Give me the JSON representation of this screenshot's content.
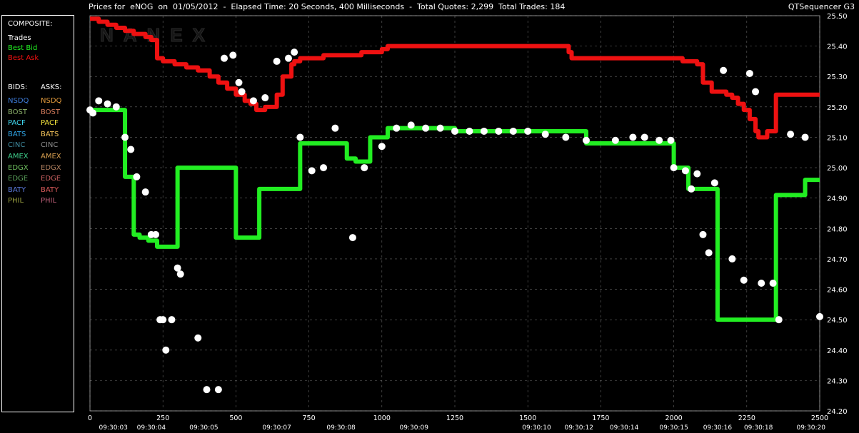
{
  "title": "Prices for  eNOG  on  01/05/2012  -  Elapsed Time: 20 Seconds, 400 Milliseconds  -  Total Quotes: 2,299  Total Trades: 184",
  "app_name": "QTSequencer G3",
  "watermark": "NANEX",
  "legend": {
    "composite_header": "COMPOSITE:",
    "composite_items": [
      {
        "label": "Trades",
        "color": "#ffffff"
      },
      {
        "label": "Best Bid",
        "color": "#22ee22"
      },
      {
        "label": "Best Ask",
        "color": "#ee1111"
      }
    ],
    "bids_header": "BIDS:",
    "asks_header": "ASKS:",
    "exchanges": [
      {
        "bid": "NSDQ",
        "ask": "NSDQ",
        "bid_color": "#3f7fe0",
        "ask_color": "#e39b3c"
      },
      {
        "bid": "BOST",
        "ask": "BOST",
        "bid_color": "#8cb06a",
        "ask_color": "#d47a5a"
      },
      {
        "bid": "PACF",
        "ask": "PACF",
        "bid_color": "#3fd6ee",
        "ask_color": "#f2e23c"
      },
      {
        "bid": "BATS",
        "ask": "BATS",
        "bid_color": "#2fa6e8",
        "ask_color": "#f5c45a"
      },
      {
        "bid": "CINC",
        "ask": "CINC",
        "bid_color": "#3f8a9e",
        "ask_color": "#8c8c8c"
      },
      {
        "bid": "AMEX",
        "ask": "AMEX",
        "bid_color": "#3fcf8c",
        "ask_color": "#d9a050"
      },
      {
        "bid": "EDGX",
        "ask": "EDGX",
        "bid_color": "#6fbf5f",
        "ask_color": "#b08060"
      },
      {
        "bid": "EDGE",
        "ask": "EDGE",
        "bid_color": "#5aa05a",
        "ask_color": "#c96060"
      },
      {
        "bid": "BATY",
        "ask": "BATY",
        "bid_color": "#5a78d8",
        "ask_color": "#d85a5a"
      },
      {
        "bid": "PHIL",
        "ask": "PHIL",
        "bid_color": "#9aa040",
        "ask_color": "#c0607a"
      }
    ]
  },
  "colors": {
    "background": "#000000",
    "grid": "#bbbbbb",
    "best_bid": "#22ee22",
    "best_ask": "#ee1111",
    "trades": "#ffffff",
    "text": "#ffffff"
  },
  "chart_data": {
    "type": "line",
    "ylim": [
      24.2,
      25.5
    ],
    "y_ticks": [
      "25.50",
      "25.40",
      "25.30",
      "25.20",
      "25.10",
      "25.00",
      "24.90",
      "24.80",
      "24.70",
      "24.60",
      "24.50",
      "24.40",
      "24.30",
      "24.20"
    ],
    "xlim": [
      0,
      2500
    ],
    "x_ticks": [
      "0",
      "250",
      "500",
      "750",
      "1000",
      "1250",
      "1500",
      "1750",
      "2000",
      "2250",
      "2500"
    ],
    "time_labels": [
      {
        "x": 80,
        "label": "09:30:03"
      },
      {
        "x": 210,
        "label": "09:30:04"
      },
      {
        "x": 390,
        "label": "09:30:05"
      },
      {
        "x": 640,
        "label": "09:30:07"
      },
      {
        "x": 860,
        "label": "09:30:08"
      },
      {
        "x": 1110,
        "label": "09:30:09"
      },
      {
        "x": 1530,
        "label": "09:30:10"
      },
      {
        "x": 1675,
        "label": "09:30:12"
      },
      {
        "x": 1830,
        "label": "09:30:14"
      },
      {
        "x": 2000,
        "label": "09:30:15"
      },
      {
        "x": 2150,
        "label": "09:30:16"
      },
      {
        "x": 2290,
        "label": "09:30:18"
      },
      {
        "x": 2470,
        "label": "09:30:20"
      }
    ],
    "grid": true,
    "series": [
      {
        "name": "Best Ask",
        "color": "#ee1111",
        "x": [
          0,
          30,
          60,
          90,
          120,
          150,
          190,
          210,
          230,
          250,
          290,
          330,
          370,
          410,
          440,
          470,
          500,
          530,
          550,
          570,
          580,
          600,
          640,
          660,
          690,
          700,
          720,
          760,
          800,
          860,
          930,
          1000,
          1020,
          1050,
          1080,
          1100,
          1150,
          1200,
          1250,
          1300,
          1350,
          1400,
          1450,
          1480,
          1500,
          1550,
          1600,
          1640,
          1650,
          1700,
          1750,
          1800,
          1850,
          1900,
          1950,
          2000,
          2030,
          2050,
          2080,
          2100,
          2130,
          2150,
          2180,
          2200,
          2220,
          2240,
          2260,
          2280,
          2290,
          2320,
          2350,
          2400,
          2450,
          2500
        ],
        "y": [
          25.49,
          25.48,
          25.47,
          25.46,
          25.45,
          25.44,
          25.43,
          25.42,
          25.36,
          25.35,
          25.34,
          25.33,
          25.32,
          25.3,
          25.28,
          25.26,
          25.24,
          25.22,
          25.21,
          25.19,
          25.19,
          25.2,
          25.24,
          25.3,
          25.34,
          25.35,
          25.36,
          25.36,
          25.37,
          25.37,
          25.38,
          25.39,
          25.4,
          25.4,
          25.4,
          25.4,
          25.4,
          25.4,
          25.4,
          25.4,
          25.4,
          25.4,
          25.4,
          25.4,
          25.4,
          25.4,
          25.4,
          25.38,
          25.36,
          25.36,
          25.36,
          25.36,
          25.36,
          25.36,
          25.36,
          25.36,
          25.35,
          25.35,
          25.34,
          25.28,
          25.25,
          25.25,
          25.24,
          25.23,
          25.21,
          25.19,
          25.16,
          25.12,
          25.1,
          25.12,
          25.24,
          25.24,
          25.24,
          25.24
        ]
      },
      {
        "name": "Best Bid",
        "color": "#22ee22",
        "x": [
          0,
          30,
          60,
          80,
          90,
          120,
          150,
          170,
          200,
          230,
          270,
          300,
          370,
          410,
          480,
          500,
          520,
          540,
          560,
          580,
          640,
          660,
          700,
          720,
          760,
          800,
          860,
          880,
          910,
          960,
          1000,
          1020,
          1050,
          1080,
          1150,
          1200,
          1250,
          1300,
          1400,
          1500,
          1550,
          1600,
          1650,
          1700,
          1750,
          1800,
          1850,
          1900,
          1950,
          2000,
          2050,
          2100,
          2150,
          2200,
          2250,
          2300,
          2320,
          2350,
          2400,
          2450,
          2500
        ],
        "y": [
          25.19,
          25.19,
          25.19,
          25.19,
          25.19,
          24.97,
          24.78,
          24.77,
          24.76,
          24.74,
          24.74,
          25.0,
          25.0,
          25.0,
          25.0,
          24.77,
          24.77,
          24.77,
          24.77,
          24.93,
          24.93,
          24.93,
          24.93,
          25.08,
          25.08,
          25.08,
          25.08,
          25.03,
          25.02,
          25.1,
          25.1,
          25.13,
          25.13,
          25.13,
          25.13,
          25.13,
          25.12,
          25.12,
          25.12,
          25.12,
          25.12,
          25.12,
          25.12,
          25.08,
          25.08,
          25.08,
          25.08,
          25.08,
          25.08,
          25.0,
          24.93,
          24.93,
          24.5,
          24.5,
          24.5,
          24.5,
          24.5,
          24.91,
          24.91,
          24.96,
          24.96
        ]
      },
      {
        "name": "Trades",
        "color": "#ffffff",
        "x": [
          0,
          10,
          30,
          60,
          90,
          120,
          140,
          160,
          190,
          210,
          225,
          240,
          250,
          260,
          280,
          300,
          310,
          370,
          400,
          440,
          460,
          490,
          510,
          520,
          560,
          600,
          640,
          680,
          700,
          720,
          760,
          800,
          840,
          900,
          940,
          1000,
          1050,
          1100,
          1150,
          1200,
          1250,
          1300,
          1350,
          1400,
          1450,
          1500,
          1560,
          1630,
          1700,
          1800,
          1860,
          1900,
          1950,
          1990,
          2000,
          2040,
          2060,
          2080,
          2100,
          2120,
          2140,
          2170,
          2200,
          2240,
          2260,
          2280,
          2300,
          2340,
          2360,
          2400,
          2450,
          2500
        ],
        "y": [
          25.19,
          25.18,
          25.22,
          25.21,
          25.2,
          25.1,
          25.06,
          24.97,
          24.92,
          24.78,
          24.78,
          24.5,
          24.5,
          24.4,
          24.5,
          24.67,
          24.65,
          24.44,
          24.27,
          24.27,
          25.36,
          25.37,
          25.28,
          25.25,
          25.22,
          25.23,
          25.35,
          25.36,
          25.38,
          25.1,
          24.99,
          25.0,
          25.13,
          24.77,
          25.0,
          25.07,
          25.13,
          25.14,
          25.13,
          25.13,
          25.12,
          25.12,
          25.12,
          25.12,
          25.12,
          25.12,
          25.11,
          25.1,
          25.09,
          25.09,
          25.1,
          25.1,
          25.09,
          25.09,
          25.0,
          24.99,
          24.93,
          24.98,
          24.78,
          24.72,
          24.95,
          25.32,
          24.7,
          24.63,
          25.31,
          25.25,
          24.62,
          24.62,
          24.5,
          25.11,
          25.1,
          24.51
        ]
      }
    ]
  }
}
